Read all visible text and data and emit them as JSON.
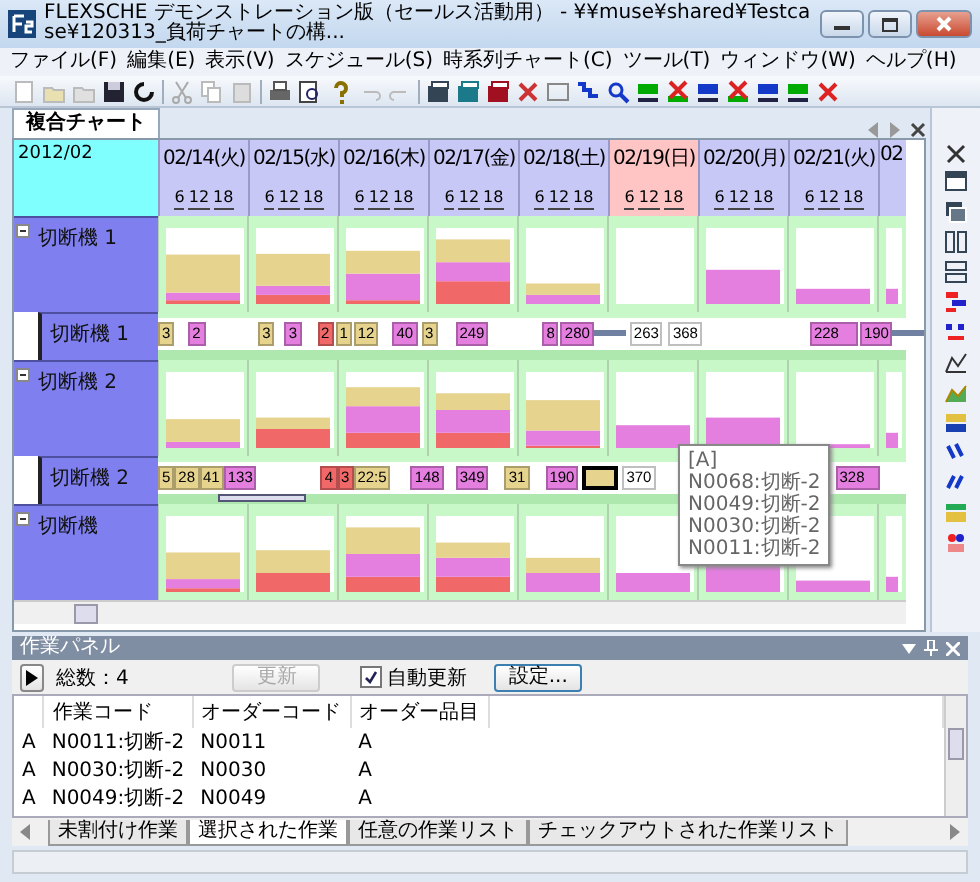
{
  "window": {
    "title": "FLEXSCHE デモンストレーション版（セールス活動用） - ¥¥muse¥shared¥Testcase¥120313_負荷チャートの構..."
  },
  "menu": [
    "ファイル(F)",
    "編集(E)",
    "表示(V)",
    "スケジュール(S)",
    "時系列チャート(C)",
    "ツール(T)",
    "ウィンドウ(W)",
    "ヘルプ(H)"
  ],
  "document_tab": {
    "label": "複合チャート",
    "selected": true
  },
  "chart": {
    "month": "2012/02",
    "days": [
      {
        "date": "02/14(火)",
        "holiday": false,
        "ticks": [
          "6",
          "12",
          "18"
        ]
      },
      {
        "date": "02/15(水)",
        "holiday": false,
        "ticks": [
          "6",
          "12",
          "18"
        ]
      },
      {
        "date": "02/16(木)",
        "holiday": false,
        "ticks": [
          "6",
          "12",
          "18"
        ]
      },
      {
        "date": "02/17(金)",
        "holiday": false,
        "ticks": [
          "6",
          "12",
          "18"
        ]
      },
      {
        "date": "02/18(土)",
        "holiday": false,
        "ticks": [
          "6",
          "12",
          "18"
        ]
      },
      {
        "date": "02/19(日)",
        "holiday": true,
        "ticks": [
          "6",
          "12",
          "18"
        ]
      },
      {
        "date": "02/20(月)",
        "holiday": false,
        "ticks": [
          "6",
          "12",
          "18"
        ]
      },
      {
        "date": "02/21(火)",
        "holiday": false,
        "ticks": [
          "6",
          "12",
          "18"
        ]
      },
      {
        "date": "02",
        "holiday": false
      }
    ],
    "rows": [
      {
        "kind": "load",
        "label": "切断機 1",
        "expanded": true
      },
      {
        "kind": "timeline",
        "label": "切断機 1",
        "bars": [
          {
            "label": "3",
            "color": "#e6d38e"
          },
          {
            "label": "2",
            "color": "#e47fe0"
          },
          {
            "label": "3",
            "color": "#e6d38e"
          },
          {
            "label": "3",
            "color": "#e47fe0"
          },
          {
            "label": "2",
            "color": "#f06868"
          },
          {
            "label": "1",
            "color": "#e6d38e"
          },
          {
            "label": "12",
            "color": "#e6d38e"
          },
          {
            "label": "40",
            "color": "#e47fe0"
          },
          {
            "label": "3",
            "color": "#e6d38e"
          },
          {
            "label": "249",
            "color": "#e47fe0"
          },
          {
            "label": "8",
            "color": "#e47fe0"
          },
          {
            "label": "280",
            "color": "#e47fe0"
          },
          {
            "label": "263",
            "color": "#ffffff"
          },
          {
            "label": "368",
            "color": "#ffffff"
          },
          {
            "label": "228",
            "color": "#e47fe0"
          },
          {
            "label": "190",
            "color": "#e47fe0"
          }
        ]
      },
      {
        "kind": "load",
        "label": "切断機 2",
        "expanded": true
      },
      {
        "kind": "timeline",
        "label": "切断機 2",
        "bars": [
          {
            "label": "5",
            "color": "#e6d38e"
          },
          {
            "label": "28",
            "color": "#e6d38e"
          },
          {
            "label": "41",
            "color": "#e6d38e"
          },
          {
            "label": "133",
            "color": "#e47fe0"
          },
          {
            "label": "4",
            "color": "#f06868"
          },
          {
            "label": "3",
            "color": "#f06868"
          },
          {
            "label": "22:5",
            "color": "#e6d38e"
          },
          {
            "label": "148",
            "color": "#e47fe0"
          },
          {
            "label": "349",
            "color": "#e47fe0"
          },
          {
            "label": "31",
            "color": "#e6d38e"
          },
          {
            "label": "190",
            "color": "#e47fe0"
          },
          {
            "label": "370",
            "color": "#ffffff"
          },
          {
            "label": "328",
            "color": "#e47fe0"
          }
        ]
      },
      {
        "kind": "load",
        "label": "切断機",
        "expanded": true
      }
    ],
    "tooltip": {
      "title": "[A]",
      "lines": [
        "N0068:切断-2",
        "N0049:切断-2",
        "N0030:切断-2",
        "N0011:切断-2"
      ]
    }
  },
  "panel": {
    "title": "作業パネル",
    "total": "総数：4",
    "refresh_button": {
      "label": "更新",
      "disabled": true
    },
    "auto_update": {
      "label": "自動更新",
      "checked": true
    },
    "settings_button": "設定...",
    "columns": [
      "作業コード",
      "オーダーコード",
      "オーダー品目"
    ],
    "rows": [
      {
        "marker": "A",
        "cells": [
          "N0011:切断-2",
          "N0011",
          "A"
        ]
      },
      {
        "marker": "A",
        "cells": [
          "N0030:切断-2",
          "N0030",
          "A"
        ]
      },
      {
        "marker": "A",
        "cells": [
          "N0049:切断-2",
          "N0049",
          "A"
        ]
      }
    ],
    "tabs": [
      {
        "label": "未割付け作業",
        "selected": false
      },
      {
        "label": "選択された作業",
        "selected": true
      },
      {
        "label": "任意の作業リスト",
        "selected": false
      },
      {
        "label": "チェックアウトされた作業リスト",
        "selected": false
      }
    ]
  }
}
